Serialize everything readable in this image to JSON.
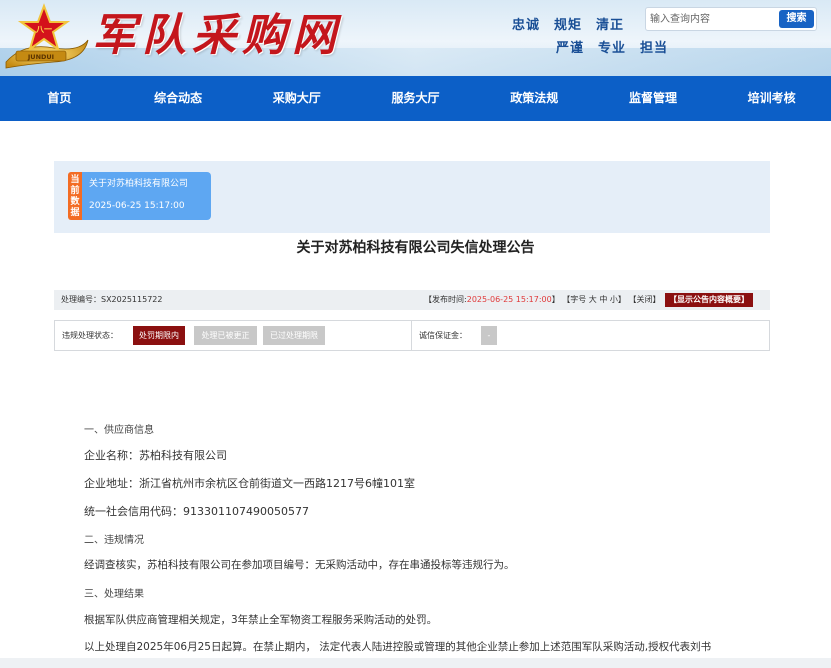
{
  "header": {
    "site_name": "军队采购网",
    "emblem_text": "八一",
    "emblem_banner": "JUNDUI",
    "motto_row1": [
      "忠诚",
      "规矩",
      "清正"
    ],
    "motto_row2": [
      "严谨",
      "专业",
      "担当"
    ],
    "search_placeholder": "输入查询内容",
    "search_button": "搜索"
  },
  "nav": [
    "首页",
    "综合动态",
    "采购大厅",
    "服务大厅",
    "政策法规",
    "监督管理",
    "培训考核"
  ],
  "current": {
    "tag": "当前数据",
    "company": "关于对苏柏科技有限公司",
    "datetime": "2025-06-25 15:17:00"
  },
  "title": "关于对苏柏科技有限公司失信处理公告",
  "meta": {
    "id_label": "处理编号：",
    "id_value": "SX2025115722",
    "publish_label": "【发布时间:",
    "publish_value": "2025-06-25 15:17:00",
    "publish_end": "】",
    "font_size": "【字号 大 中 小】",
    "close": "【关闭】",
    "summary_button": "【显示公告内容概要】"
  },
  "status": {
    "label": "违规处理状态：",
    "states": [
      "处罚期限内",
      "处理已被更正",
      "已过处理期限"
    ],
    "deposit_label": "诚信保证金：",
    "deposit_value": "-"
  },
  "colors": {
    "nav_bg": "#0c5fc7",
    "active_state": "#8b1010",
    "inactive_state": "#c8c8c8",
    "tag_orange": "#f36c24",
    "card_blue": "#5ea7f2"
  },
  "body": {
    "s1": "一、供应商信息",
    "name": "企业名称：苏柏科技有限公司",
    "addr": "企业地址：浙江省杭州市余杭区仓前街道文一西路1217号6幢101室",
    "code": "统一社会信用代码：913301107490050577",
    "s2": "二、违规情况",
    "violation": "经调查核实，苏柏科技有限公司在参加项目编号：无采购活动中，存在串通投标等违规行为。",
    "s3": "三、处理结果",
    "result": "根据军队供应商管理相关规定，3年禁止全军物资工程服务采购活动的处罚。",
    "start": "以上处理自2025年06月25日起算。在禁止期内， 法定代表人陆进控股或管理的其他企业禁止参加上述范围军队采购活动,授权代表刘书"
  }
}
